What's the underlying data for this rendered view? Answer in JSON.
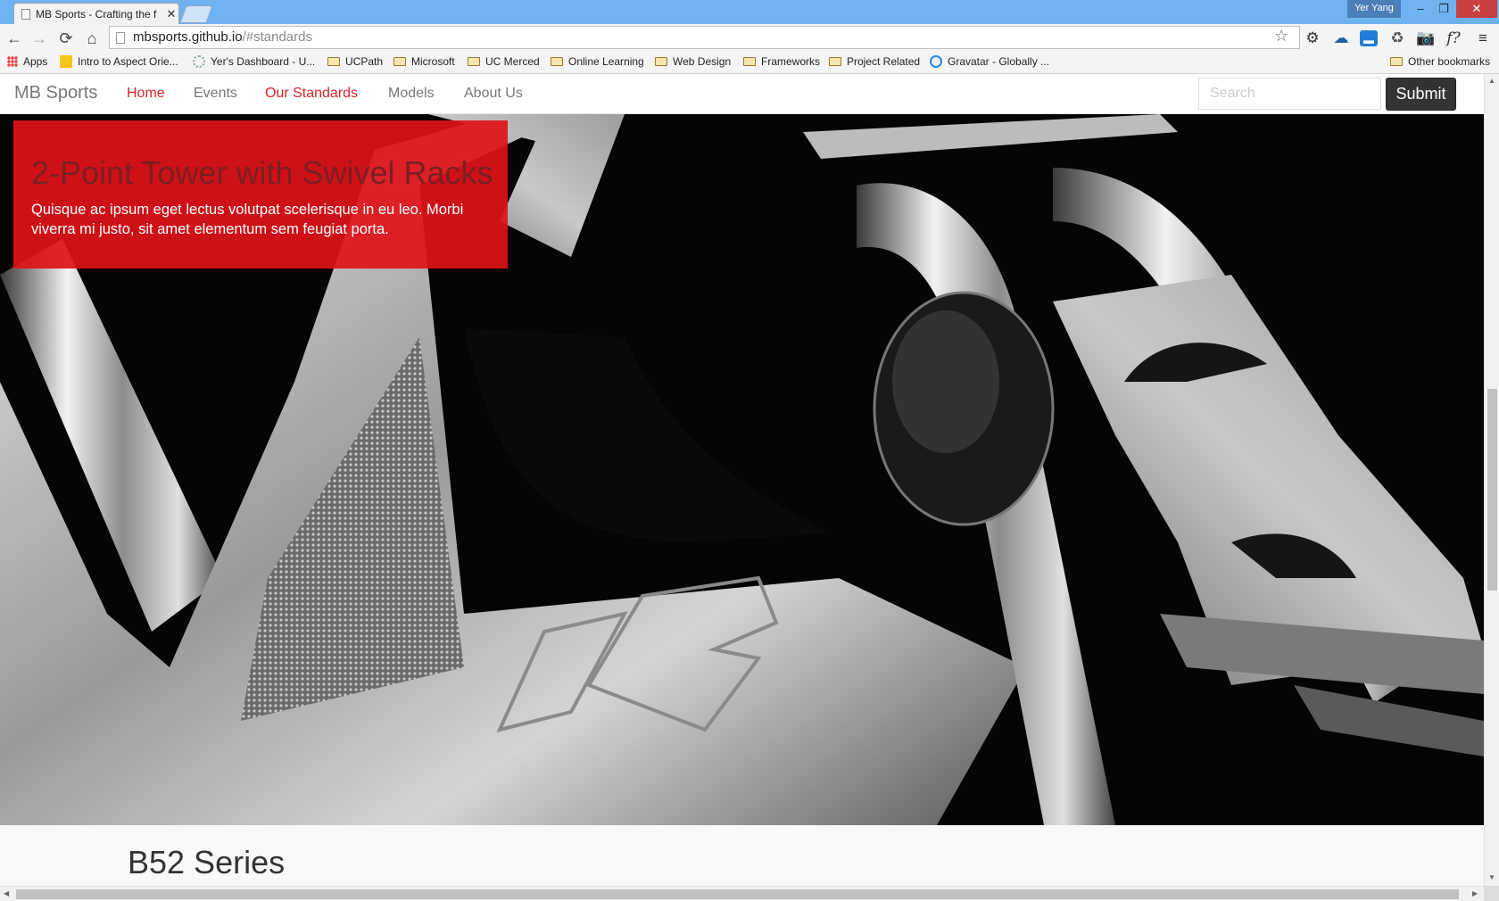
{
  "browser": {
    "tab_title": "MB Sports - Crafting the f",
    "tab_close": "✕",
    "user_name": "Yer Yang",
    "window_controls": {
      "minimize": "–",
      "maximize": "❐",
      "close": "✕"
    },
    "nav_icons": {
      "back": "←",
      "forward": "→",
      "reload": "⟳",
      "home": "⌂"
    },
    "url_host": "mbsports.github.io",
    "url_path": "/#standards",
    "star_icon": "☆",
    "extensions": [
      "⚙",
      "☁",
      "▬",
      "♻",
      "📷",
      "f?",
      "≡"
    ],
    "bookmarks": [
      {
        "label": "Apps",
        "icon": "apps-grid"
      },
      {
        "label": "Intro to Aspect Orie...",
        "icon": "yellow-square"
      },
      {
        "label": "Yer's Dashboard - U...",
        "icon": "gear"
      },
      {
        "label": "UCPath",
        "icon": "folder"
      },
      {
        "label": "Microsoft",
        "icon": "folder"
      },
      {
        "label": "UC Merced",
        "icon": "folder"
      },
      {
        "label": "Online Learning",
        "icon": "folder"
      },
      {
        "label": "Web Design",
        "icon": "folder"
      },
      {
        "label": "Frameworks",
        "icon": "folder"
      },
      {
        "label": "Project Related",
        "icon": "folder"
      },
      {
        "label": "Gravatar - Globally ...",
        "icon": "power"
      }
    ],
    "other_bookmarks": "Other bookmarks"
  },
  "site": {
    "brand": "MB Sports",
    "nav": [
      "Home",
      "Events",
      "Our Standards",
      "Models",
      "About Us"
    ],
    "search_placeholder": "Search",
    "submit_label": "Submit",
    "accent_color": "#d9232d"
  },
  "hero": {
    "caption_title": "2-Point Tower with Swivel Racks",
    "caption_text": "Quisque ac ipsum eget lectus volutpat scelerisque in eu leo. Morbi viverra mi justo, sit amet elementum sem feugiat porta."
  },
  "section": {
    "title": "B52 Series"
  },
  "scrollbar": {
    "up": "▲",
    "down": "▼",
    "left": "◀",
    "right": "▶"
  }
}
